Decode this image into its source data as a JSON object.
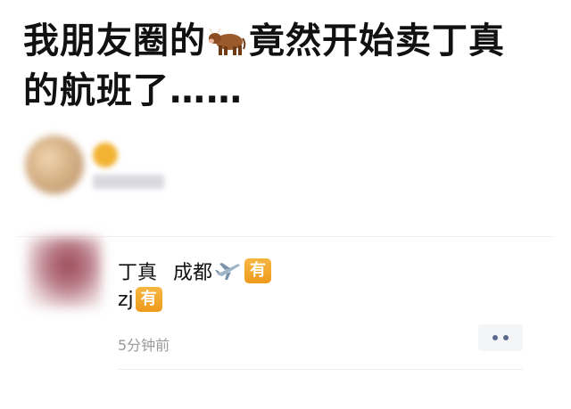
{
  "headline": {
    "line1_before": "我朋友圈的",
    "line1_emoji": "cow-emoji",
    "line1_after": "竟然开始卖丁真",
    "line2": "的航班了……"
  },
  "post_author": {
    "avatar": "blurred",
    "name": "blurred"
  },
  "comment": {
    "line1_text1": "丁真",
    "line1_text2": "成都",
    "line1_emoji": "airplane-emoji",
    "badge": "有",
    "line2_text": "zj",
    "time": "5分钟前",
    "more_icon": "more-dots-icon"
  },
  "colors": {
    "badge": "#f0a52a",
    "more_dots": "#5b6b8c",
    "time": "#9a9a9a"
  }
}
